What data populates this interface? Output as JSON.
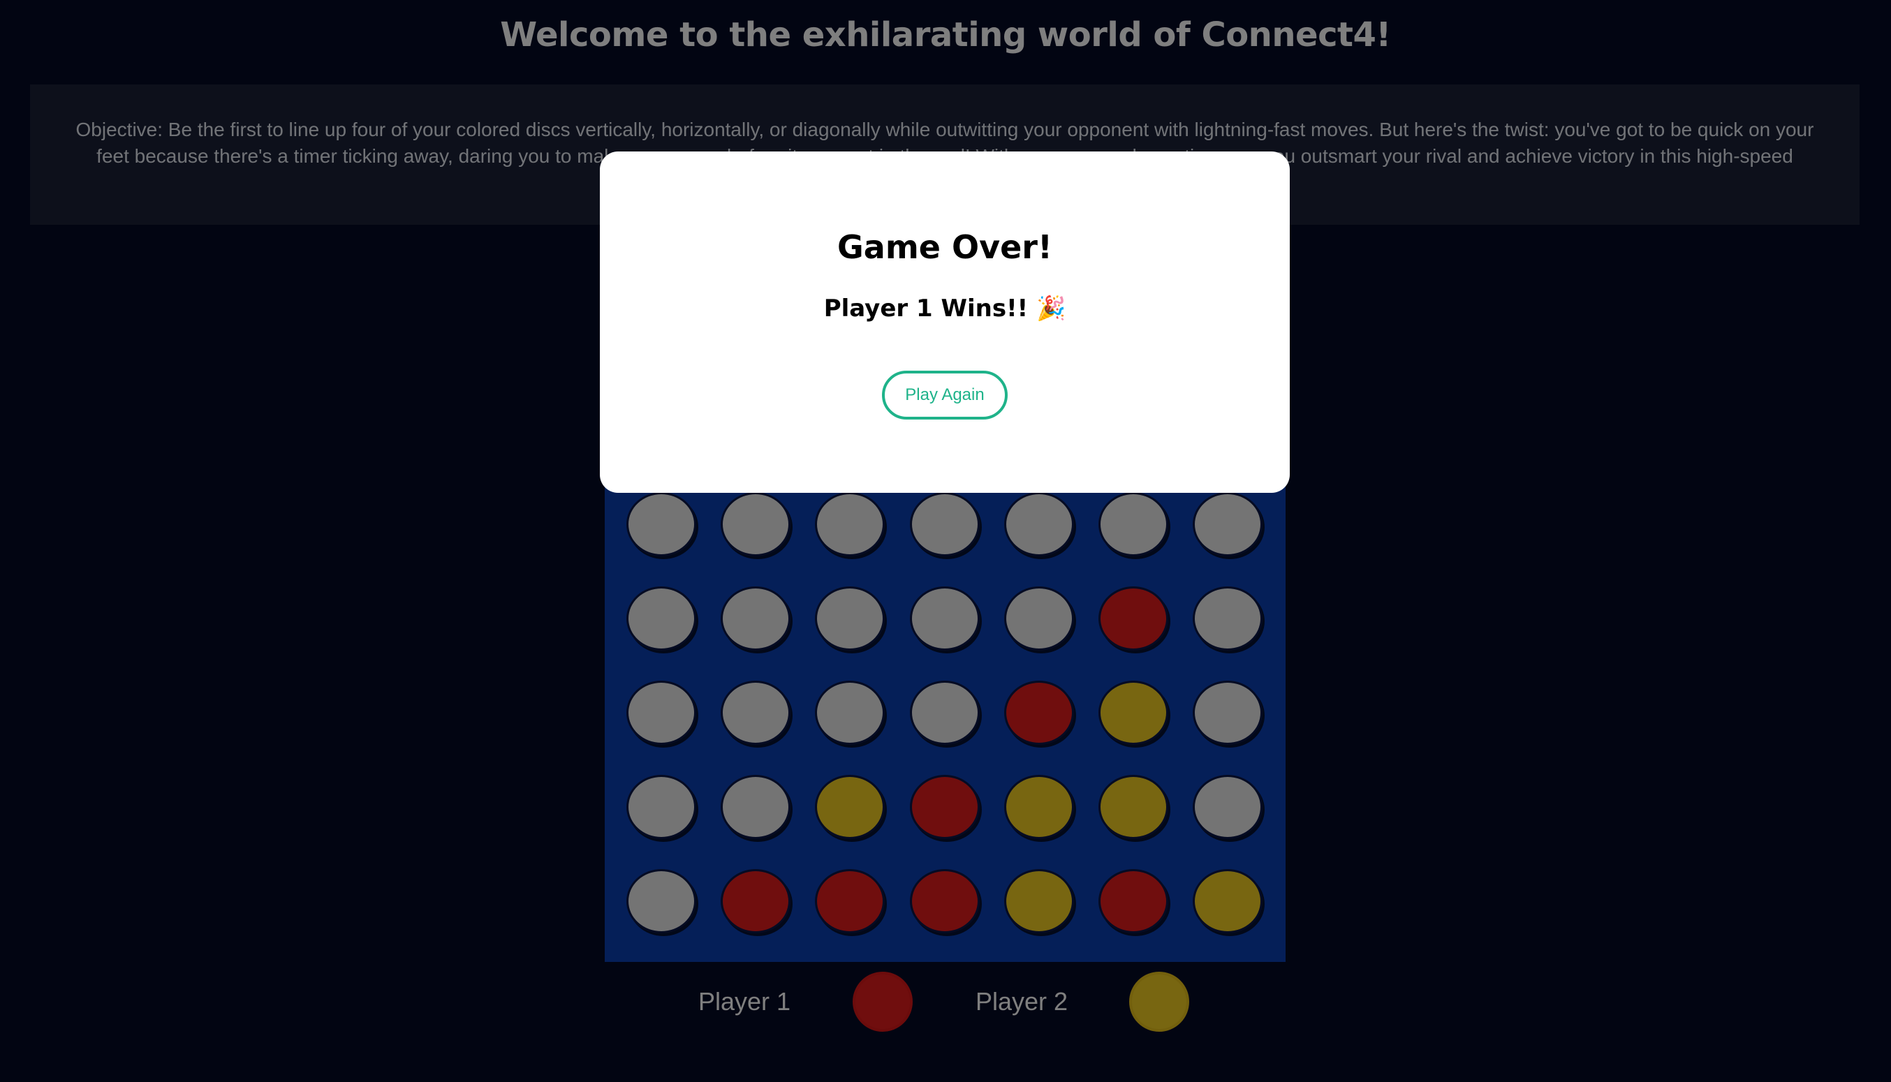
{
  "header": {
    "title": "Welcome to the exhilarating world of Connect4!"
  },
  "objective": {
    "text": "Objective: Be the first to line up four of your colored discs vertically, horizontally, or diagonally while outwitting your opponent with lightning-fast moves. But here's the twist: you've got to be quick on your feet because there's a timer ticking away, daring you to make your move before it runs out in the end! With every second counting, can you outsmart your rival and achieve victory in this high-speed"
  },
  "board": {
    "columns": 7,
    "visible_rows": [
      [
        "empty",
        "empty",
        "empty",
        "empty",
        "empty",
        "empty",
        "empty"
      ],
      [
        "empty",
        "empty",
        "empty",
        "empty",
        "empty",
        "red",
        "empty"
      ],
      [
        "empty",
        "empty",
        "empty",
        "empty",
        "red",
        "yellow",
        "empty"
      ],
      [
        "empty",
        "empty",
        "yellow",
        "red",
        "yellow",
        "yellow",
        "empty"
      ],
      [
        "empty",
        "red",
        "red",
        "red",
        "yellow",
        "red",
        "yellow"
      ]
    ],
    "colors": {
      "board": "#0a3fb0",
      "empty": "#e8e8e8",
      "red": "#e11d1d",
      "yellow": "#f0cc22"
    }
  },
  "legend": {
    "player1_label": "Player 1",
    "player1_color": "red",
    "player2_label": "Player 2",
    "player2_color": "yellow"
  },
  "modal": {
    "title": "Game Over!",
    "result": "Player 1 Wins!! 🎉",
    "button_label": "Play Again",
    "accent_color": "#1fb38a"
  }
}
